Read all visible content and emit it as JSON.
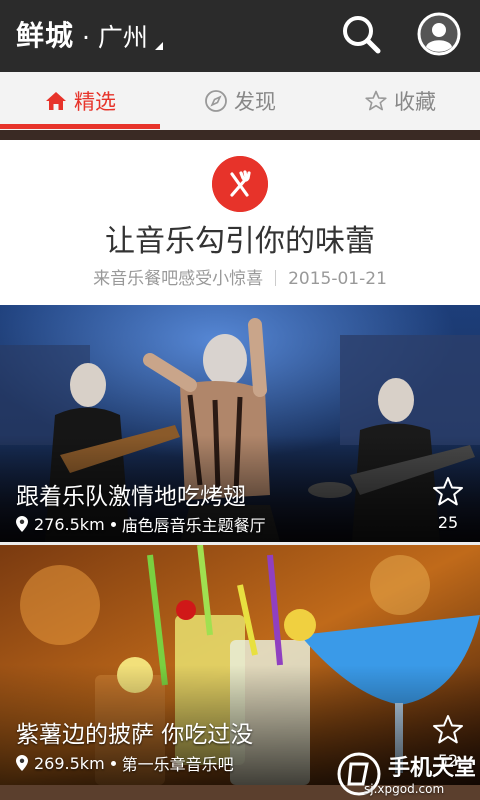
{
  "header": {
    "brand": "鲜城",
    "city": "· 广州",
    "search_icon": "search-icon",
    "user_icon": "user-avatar-icon"
  },
  "tabs": [
    {
      "label": "精选",
      "icon": "home-icon",
      "active": true
    },
    {
      "label": "发现",
      "icon": "compass-icon",
      "active": false
    },
    {
      "label": "收藏",
      "icon": "star-icon",
      "active": false
    }
  ],
  "hero": {
    "icon": "fork-knife-icon",
    "title": "让音乐勾引你的味蕾",
    "subtitle": "来音乐餐吧感受小惊喜",
    "date": "2015-01-21"
  },
  "cards": [
    {
      "title": "跟着乐队激情地吃烤翅",
      "distance": "276.5km",
      "venue": "庙色唇音乐主题餐厅",
      "favorites": "25"
    },
    {
      "title": "紫薯边的披萨 你吃过没",
      "distance": "269.5km",
      "venue": "第一乐章音乐吧",
      "favorites": "52"
    }
  ],
  "watermark": {
    "name": "手机天堂",
    "url": "sj.xpgod.com"
  },
  "colors": {
    "accent": "#e7332a",
    "appbar": "#2b2b2b"
  }
}
